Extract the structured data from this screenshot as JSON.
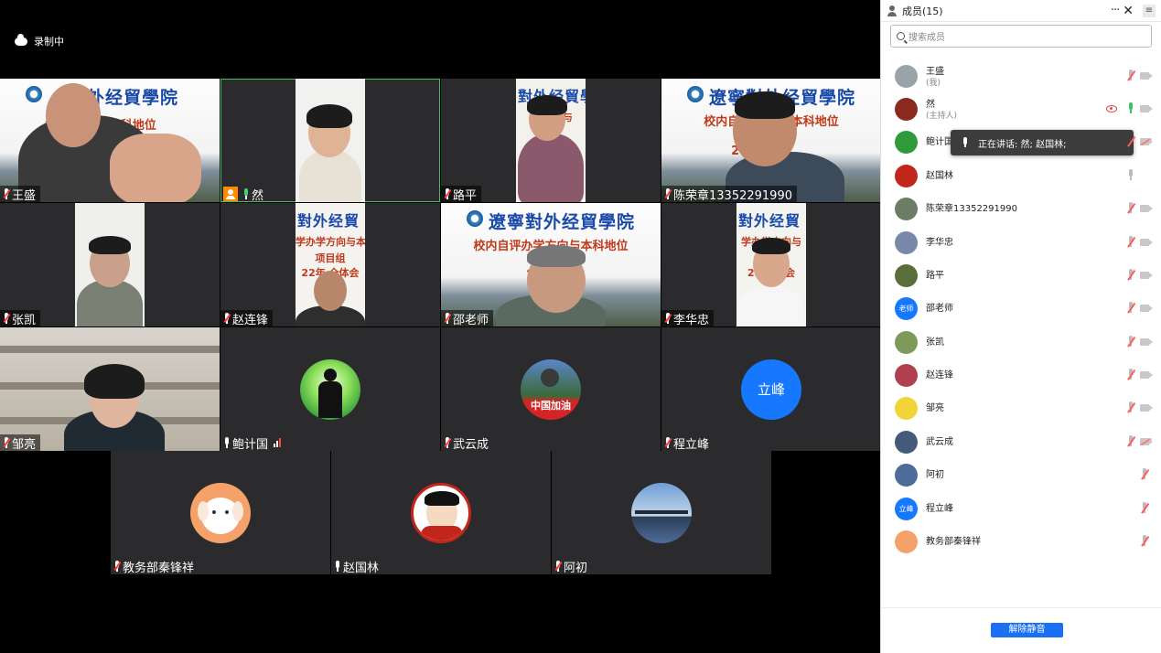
{
  "recording": {
    "label": "录制中"
  },
  "tiles": {
    "wangsheng": {
      "name": "王盛",
      "slide_title": "外经貿學院",
      "slide_sub": "校内 方向与本科地位"
    },
    "ran": {
      "name": "然"
    },
    "luping": {
      "name": "路平",
      "slide_title": "對外经貿學院",
      "slide_sub": "学办 向与"
    },
    "chenrongzhang": {
      "name": "陈荣章13352291990",
      "slide_title": "遼寧對外经貿學院",
      "slide_sub": "校内自评 方向与本科地位",
      "slide_sub2": "202 会议"
    },
    "zhangkai": {
      "name": "张凯"
    },
    "zhaolianfeng": {
      "name": "赵连锋",
      "slide_title": "對外经貿",
      "slide_sub": "学办学方向与本",
      "slide_sub2": "项目组",
      "slide_sub3": "22年 全体会"
    },
    "shaolaoshi": {
      "name": "邵老师",
      "slide_title": "遼寧對外经貿學院",
      "slide_sub": "校内自评办学方向与本科地位",
      "slide_sub2": "2022 议"
    },
    "lihuazhong": {
      "name": "李华忠",
      "slide_title": "對外经貿",
      "slide_sub": "学办学方向与",
      "slide_sub2": "项目组",
      "slide_sub3": "22年 体会"
    },
    "zouliang": {
      "name": "邹亮"
    },
    "baojiguo": {
      "name": "鲍计国"
    },
    "wuyuncheng": {
      "name": "武云成",
      "avatar_text": "中国加油"
    },
    "chenglifeng": {
      "name": "程立峰",
      "avatar_text": "立峰"
    },
    "qinfengxiang": {
      "name": "教务部秦锋祥"
    },
    "zhaoguolin": {
      "name": "赵国林"
    },
    "achu": {
      "name": "阿初"
    }
  },
  "panel": {
    "title": "成员(15)",
    "more": "···",
    "close": "✕",
    "collapse": "≡",
    "search_placeholder": "搜索成员",
    "unmute_all": "解除静音",
    "tooltip": "正在讲话: 然; 赵国林;",
    "members": [
      {
        "name": "王盛",
        "sub": "(我)",
        "avatar_color": "#9aa3a8"
      },
      {
        "name": "然",
        "sub": "(主持人)",
        "avatar_color": "#8a2a1e"
      },
      {
        "name": "鲍计国",
        "sub": "",
        "avatar_color": "#2f9a3a"
      },
      {
        "name": "赵国林",
        "sub": "",
        "avatar_color": "#c2261b"
      },
      {
        "name": "陈荣章13352291990",
        "sub": "",
        "avatar_color": "#6d7c64"
      },
      {
        "name": "李华忠",
        "sub": "",
        "avatar_color": "#7788aa"
      },
      {
        "name": "路平",
        "sub": "",
        "avatar_color": "#5a6e3a"
      },
      {
        "name": "邵老师",
        "sub": "",
        "avatar_color": "#1677ff",
        "avatar_text": "老师"
      },
      {
        "name": "张凯",
        "sub": "",
        "avatar_color": "#7d9a5a"
      },
      {
        "name": "赵连锋",
        "sub": "",
        "avatar_color": "#b04050"
      },
      {
        "name": "邹亮",
        "sub": "",
        "avatar_color": "#f2d33a"
      },
      {
        "name": "武云成",
        "sub": "",
        "avatar_color": "#445a7a"
      },
      {
        "name": "阿初",
        "sub": "",
        "avatar_color": "#4e6c9a"
      },
      {
        "name": "程立峰",
        "sub": "",
        "avatar_color": "#1677ff",
        "avatar_text": "立峰"
      },
      {
        "name": "教务部秦锋祥",
        "sub": "",
        "avatar_color": "#f5a26a"
      }
    ]
  }
}
